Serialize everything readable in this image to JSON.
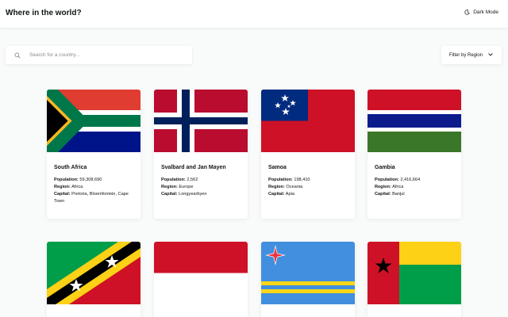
{
  "header": {
    "title": "Where in the world?",
    "dark_mode_label": "Dark Mode"
  },
  "search": {
    "placeholder": "Search for a country..."
  },
  "filter": {
    "label": "Filter by Region"
  },
  "labels": {
    "population": "Population:",
    "region": "Region:",
    "capital": "Capital:"
  },
  "countries": [
    {
      "name": "South Africa",
      "population": "59,308,690",
      "region": "Africa",
      "capital": "Pretoria, Bloemfontein, Cape Town"
    },
    {
      "name": "Svalbard and Jan Mayen",
      "population": "2,562",
      "region": "Europe",
      "capital": "Longyearbyen"
    },
    {
      "name": "Samoa",
      "population": "198,410",
      "region": "Oceania",
      "capital": "Apia"
    },
    {
      "name": "Gambia",
      "population": "2,416,664",
      "region": "Africa",
      "capital": "Banjul"
    }
  ],
  "colors": {
    "background": "#f9fafa",
    "text": "#111517"
  }
}
